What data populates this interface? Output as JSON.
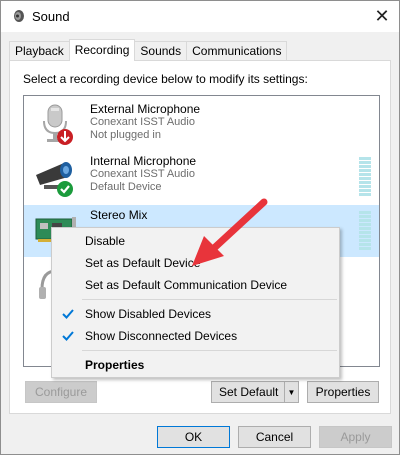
{
  "window": {
    "title": "Sound",
    "close_glyph": "✕"
  },
  "tabs": [
    {
      "label": "Playback",
      "active": false
    },
    {
      "label": "Recording",
      "active": true
    },
    {
      "label": "Sounds",
      "active": false
    },
    {
      "label": "Communications",
      "active": false
    }
  ],
  "instruction": "Select a recording device below to modify its settings:",
  "devices": [
    {
      "name": "External Microphone",
      "driver": "Conexant ISST Audio",
      "status": "Not plugged in",
      "icon": "microphone-icon",
      "badge": "red-down-arrow-badge"
    },
    {
      "name": "Internal Microphone",
      "driver": "Conexant ISST Audio",
      "status": "Default Device",
      "icon": "webcam-microphone-icon",
      "badge": "green-check-badge"
    },
    {
      "name": "Stereo Mix",
      "icon": "sound-card-icon",
      "selected": true
    },
    {
      "icon": "headset-icon"
    }
  ],
  "context_menu": {
    "items": [
      {
        "label": "Disable",
        "checked": false
      },
      {
        "label": "Set as Default Device",
        "checked": false
      },
      {
        "label": "Set as Default Communication Device",
        "checked": false
      },
      {
        "label": "Show Disabled Devices",
        "checked": true
      },
      {
        "label": "Show Disconnected Devices",
        "checked": true
      },
      {
        "label": "Properties",
        "checked": false,
        "bold": true
      }
    ]
  },
  "buttons": {
    "configure": "Configure",
    "set_default": "Set Default",
    "split_arrow": "▼",
    "properties": "Properties",
    "ok": "OK",
    "cancel": "Cancel",
    "apply": "Apply"
  },
  "colors": {
    "selection": "#cce8ff",
    "annotation_arrow": "#e8343b",
    "check_blue": "#0078d7",
    "level_meter": "#b5e4ea"
  }
}
